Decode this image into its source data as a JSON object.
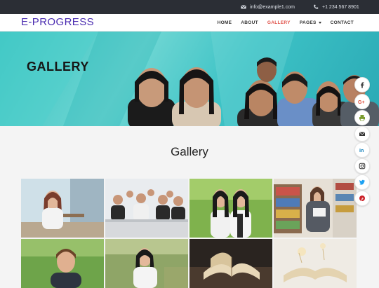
{
  "topbar": {
    "email": "info@example1.com",
    "phone": "+1 234 567 8901"
  },
  "brand": {
    "name": "E-PROGRESS",
    "color": "#4a2bb0"
  },
  "nav": {
    "items": [
      {
        "label": "HOME"
      },
      {
        "label": "ABOUT"
      },
      {
        "label": "GALLERY",
        "active": true
      },
      {
        "label": "PAGES"
      },
      {
        "label": "CONTACT"
      }
    ]
  },
  "banner": {
    "title": "GALLERY"
  },
  "main": {
    "title": "Gallery"
  },
  "gallery": {
    "tiles": [
      {
        "name": "woman-using-phone"
      },
      {
        "name": "students-in-classroom"
      },
      {
        "name": "two-girls-outdoors"
      },
      {
        "name": "woman-reading-in-library"
      },
      {
        "name": "boy-outdoors"
      },
      {
        "name": "girl-in-field"
      },
      {
        "name": "open-book-dark"
      },
      {
        "name": "open-book-light"
      }
    ]
  },
  "social": {
    "icons": [
      "facebook-icon",
      "google-plus-icon",
      "print-icon",
      "email-icon",
      "linkedin-icon",
      "instagram-icon",
      "twitter-icon",
      "pinterest-icon"
    ]
  },
  "colors": {
    "accent": "#e0524a",
    "topbar": "#2b2e35",
    "banner": "#35c2c0"
  }
}
